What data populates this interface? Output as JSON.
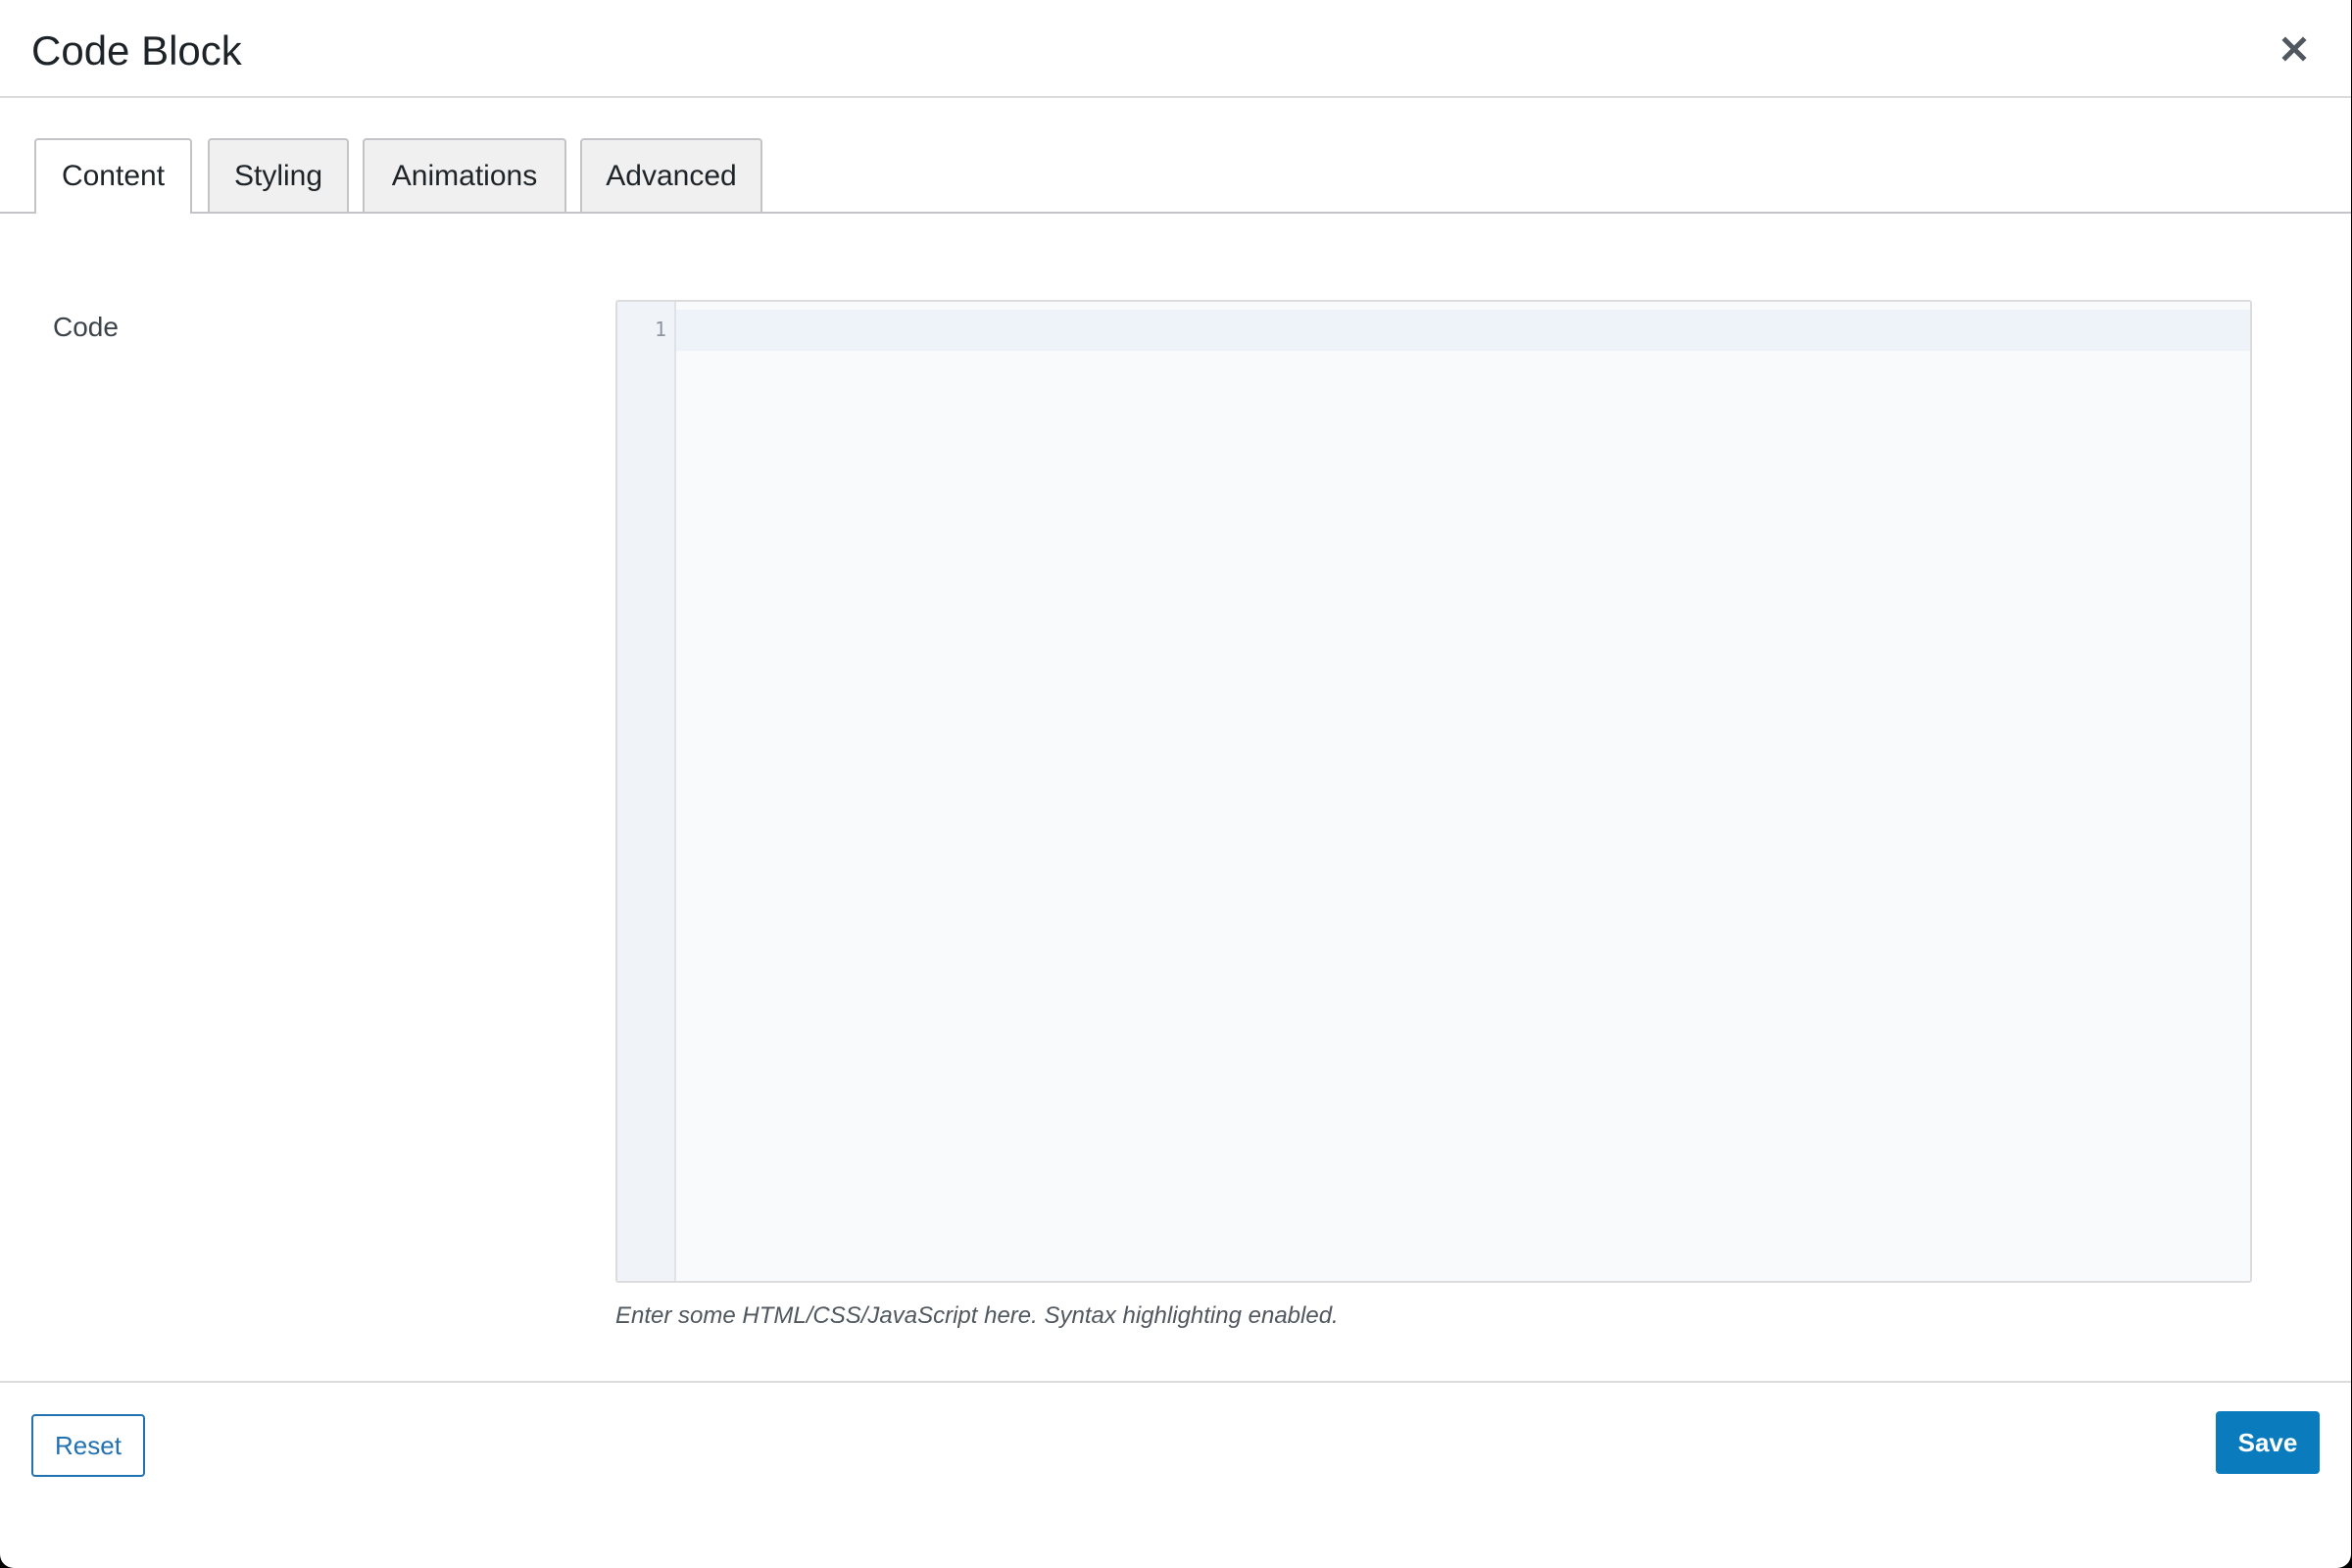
{
  "modal": {
    "title": "Code Block",
    "close_icon": "close-icon"
  },
  "tabs": [
    {
      "label": "Content",
      "active": true
    },
    {
      "label": "Styling",
      "active": false
    },
    {
      "label": "Animations",
      "active": false
    },
    {
      "label": "Advanced",
      "active": false
    }
  ],
  "field": {
    "label": "Code",
    "editor": {
      "line_numbers": [
        "1"
      ],
      "value": ""
    },
    "help_text": "Enter some HTML/CSS/JavaScript here. Syntax highlighting enabled."
  },
  "footer": {
    "reset_label": "Reset",
    "save_label": "Save"
  },
  "colors": {
    "accent": "#2271b1",
    "save_button": "#0a7bbd"
  }
}
